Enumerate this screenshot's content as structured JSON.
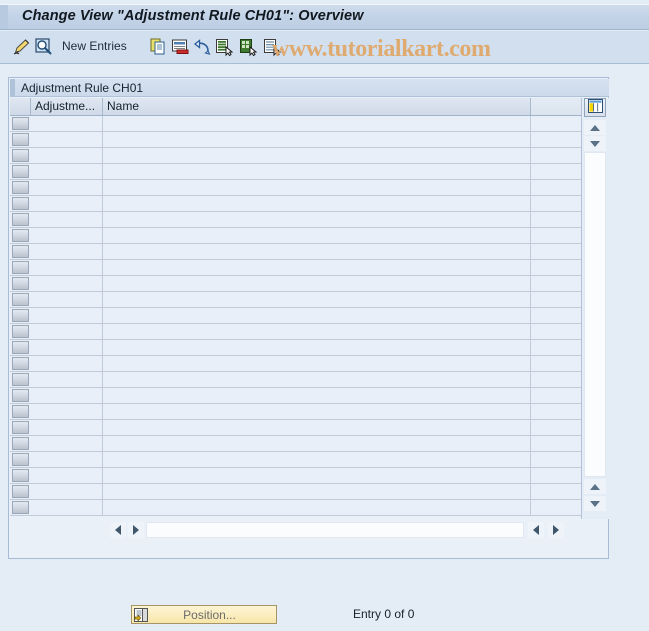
{
  "window": {
    "title": "Change View \"Adjustment Rule CH01\": Overview"
  },
  "watermark": {
    "text": "www.tutorialkart.com",
    "color": "#e0a86a"
  },
  "toolbar": {
    "new_entries_label": "New Entries",
    "buttons": [
      {
        "name": "change-display-icon",
        "tooltip": "Display <-> Change"
      },
      {
        "name": "display-details-icon",
        "tooltip": "Display Details"
      },
      {
        "name": "copy-as-icon",
        "tooltip": "Copy As..."
      },
      {
        "name": "delete-icon",
        "tooltip": "Delete"
      },
      {
        "name": "undo-icon",
        "tooltip": "Undo Change"
      },
      {
        "name": "select-all-icon",
        "tooltip": "Select All"
      },
      {
        "name": "select-block-icon",
        "tooltip": "Select Block"
      },
      {
        "name": "deselect-all-icon",
        "tooltip": "Deselect All"
      }
    ]
  },
  "panel": {
    "header": "Adjustment Rule CH01",
    "settings_icon": "table-settings-icon"
  },
  "table": {
    "columns": [
      {
        "key": "select",
        "label": ""
      },
      {
        "key": "adjustment_rule",
        "label": "Adjustme..."
      },
      {
        "key": "name",
        "label": "Name"
      }
    ],
    "rows": [],
    "empty_row_count": 25
  },
  "footer": {
    "position_button_label": "Position...",
    "position_button_icon": "position-icon",
    "entry_count": "Entry 0 of 0"
  },
  "colors": {
    "window_background": "#e4ecf5",
    "titlebar": "#c3d3e7",
    "toolbar": "#d2dfee",
    "grid_row": "#e9eff8",
    "grid_line": "#bfcbd9",
    "panel_border": "#a7bcd4",
    "button_yellow": "#fbeec0"
  }
}
